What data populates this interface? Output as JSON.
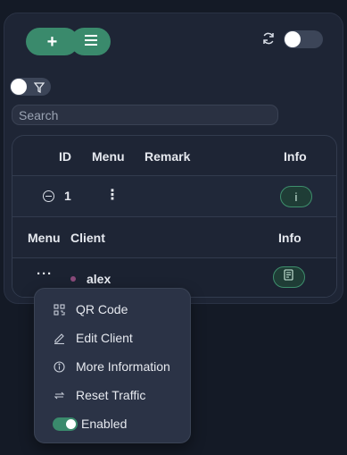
{
  "toolbar": {
    "add_icon": "+",
    "list_icon": "list-icon",
    "refresh_icon": "refresh-icon",
    "filter_icon": "filter-icon"
  },
  "search": {
    "placeholder": "Search"
  },
  "inbound_table": {
    "headers": {
      "id": "ID",
      "menu": "Menu",
      "remark": "Remark",
      "info": "Info"
    },
    "rows": [
      {
        "id": "1",
        "menu": "⋮",
        "info": "i"
      }
    ]
  },
  "client_table": {
    "headers": {
      "menu": "Menu",
      "client": "Client",
      "info": "Info"
    },
    "rows": [
      {
        "menu": "···",
        "client": "alex",
        "status_color": "#8a4a7a"
      }
    ]
  },
  "context_menu": {
    "items": [
      {
        "label": "QR Code",
        "icon": "qr-code-icon"
      },
      {
        "label": "Edit Client",
        "icon": "edit-icon"
      },
      {
        "label": "More Information",
        "icon": "info-icon"
      },
      {
        "label": "Reset Traffic",
        "icon": "reset-icon"
      }
    ],
    "enabled_label": "Enabled"
  },
  "colors": {
    "accent": "#3a8a6c",
    "background": "#141a26",
    "card": "#1e2535"
  }
}
